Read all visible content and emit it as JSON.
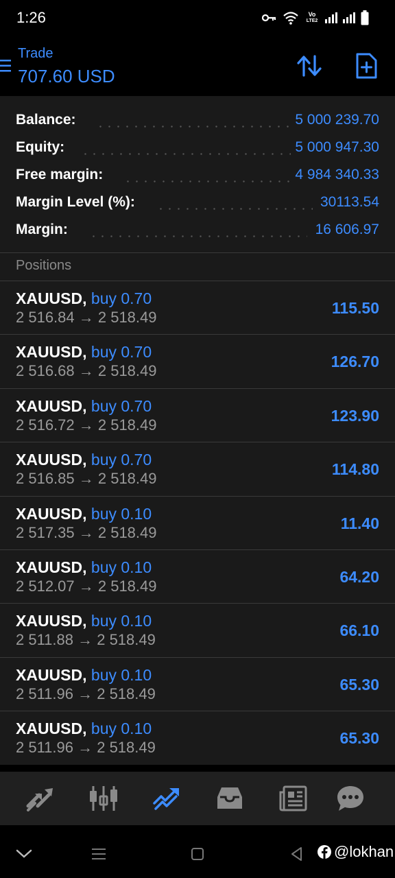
{
  "status_bar": {
    "time": "1:26",
    "volte_top": "Vo",
    "volte_bottom": "LTE2"
  },
  "header": {
    "title": "Trade",
    "subtitle": "707.60 USD"
  },
  "account": [
    {
      "label": "Balance:",
      "value": "5 000 239.70"
    },
    {
      "label": "Equity:",
      "value": "5 000 947.30"
    },
    {
      "label": "Free margin:",
      "value": "4 984 340.33"
    },
    {
      "label": "Margin Level (%):",
      "value": "30113.54"
    },
    {
      "label": "Margin:",
      "value": "16 606.97"
    }
  ],
  "positions_title": "Positions",
  "positions": [
    {
      "symbol": "XAUUSD,",
      "type": "buy 0.70",
      "prices": "2 516.84 → 2 518.49",
      "profit": "115.50"
    },
    {
      "symbol": "XAUUSD,",
      "type": "buy 0.70",
      "prices": "2 516.68 → 2 518.49",
      "profit": "126.70"
    },
    {
      "symbol": "XAUUSD,",
      "type": "buy 0.70",
      "prices": "2 516.72 → 2 518.49",
      "profit": "123.90"
    },
    {
      "symbol": "XAUUSD,",
      "type": "buy 0.70",
      "prices": "2 516.85 → 2 518.49",
      "profit": "114.80"
    },
    {
      "symbol": "XAUUSD,",
      "type": "buy 0.10",
      "prices": "2 517.35 → 2 518.49",
      "profit": "11.40"
    },
    {
      "symbol": "XAUUSD,",
      "type": "buy 0.10",
      "prices": "2 512.07 → 2 518.49",
      "profit": "64.20"
    },
    {
      "symbol": "XAUUSD,",
      "type": "buy 0.10",
      "prices": "2 511.88 → 2 518.49",
      "profit": "66.10"
    },
    {
      "symbol": "XAUUSD,",
      "type": "buy 0.10",
      "prices": "2 511.96 → 2 518.49",
      "profit": "65.30"
    },
    {
      "symbol": "XAUUSD,",
      "type": "buy 0.10",
      "prices": "2 511.96 → 2 518.49",
      "profit": "65.30"
    }
  ],
  "tabs": [
    {
      "icon": "quotes-icon",
      "active": false
    },
    {
      "icon": "chart-candles-icon",
      "active": false
    },
    {
      "icon": "trade-icon",
      "active": true
    },
    {
      "icon": "history-inbox-icon",
      "active": false
    },
    {
      "icon": "news-icon",
      "active": false
    },
    {
      "icon": "chat-icon",
      "active": false
    }
  ],
  "watermark": {
    "text": "@lokhan",
    "icon": "facebook-icon"
  },
  "colors": {
    "accent": "#3d8cff",
    "panel": "#1a1a1a",
    "muted": "#9a9a9a",
    "divider": "#3a3a3a"
  }
}
